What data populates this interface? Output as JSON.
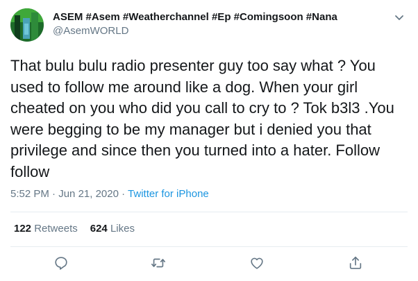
{
  "author": {
    "display_name": "ASEM #Asem #Weatherchannel #Ep #Comingsoon #Nana",
    "handle": "@AsemWORLD"
  },
  "tweet": {
    "text": "That bulu bulu radio presenter guy too say what ? You used to follow me around like a dog. When your girl cheated on you who did you call to cry to ? Tok b3l3 .You were begging to be my manager but i denied you that privilege and since then you turned into a hater. Follow follow",
    "time": "5:52 PM",
    "separator": "·",
    "date": "Jun 21, 2020",
    "source": "Twitter for iPhone"
  },
  "stats": {
    "retweets_count": "122",
    "retweets_label": "Retweets",
    "likes_count": "624",
    "likes_label": "Likes"
  },
  "icons": {
    "caret": "chevron-down-icon",
    "reply": "reply-icon",
    "retweet": "retweet-icon",
    "like": "heart-icon",
    "share": "share-icon"
  },
  "colors": {
    "text": "#14171a",
    "secondary": "#657786",
    "link": "#1b95e0",
    "divider": "#e6ecf0"
  }
}
